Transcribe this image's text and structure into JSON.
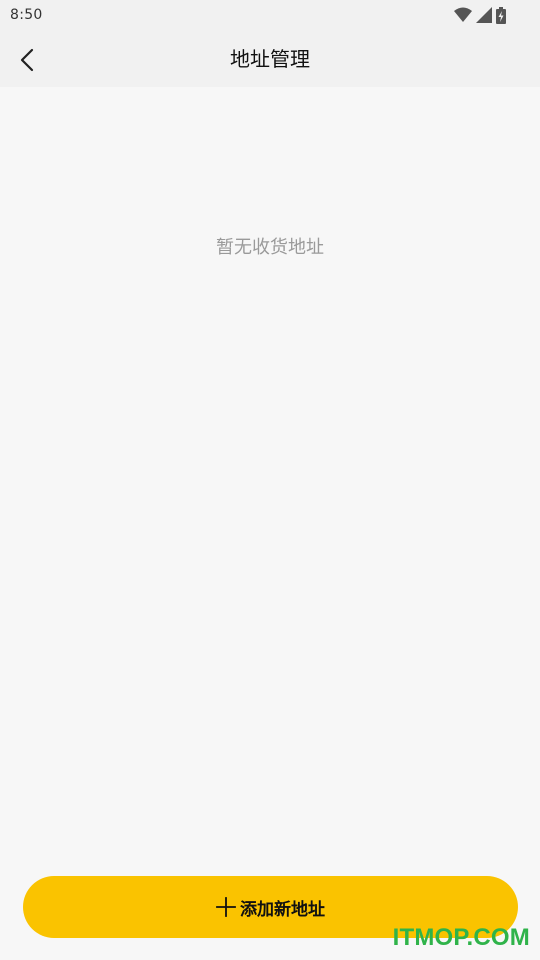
{
  "status_bar": {
    "time": "8:50",
    "icons": [
      "wifi-icon",
      "cellular-signal-icon",
      "battery-charging-icon"
    ]
  },
  "header": {
    "title": "地址管理",
    "back_icon": "chevron-left-icon"
  },
  "main": {
    "empty_message": "暂无收货地址"
  },
  "footer": {
    "add_button_label": "添加新地址",
    "add_icon": "plus-icon"
  },
  "watermark": {
    "text": "ITMOP.COM"
  },
  "colors": {
    "accent": "#fac300",
    "background": "#f7f7f7",
    "header_background": "#f1f1f1",
    "empty_text": "#9a9a9a",
    "watermark": "#2fb34a"
  }
}
